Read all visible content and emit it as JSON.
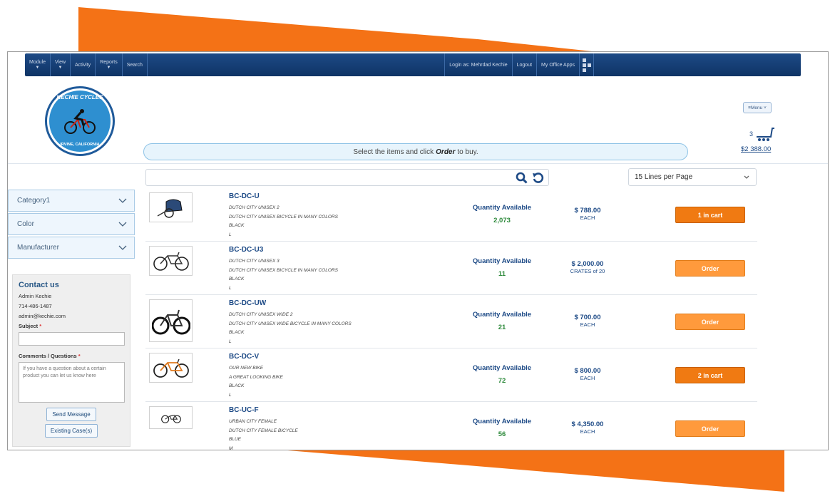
{
  "nav": {
    "items": [
      "Module",
      "View",
      "Activity",
      "Reports",
      "Search"
    ],
    "right_items": [
      "Login as: Mehrdad Kechie",
      "Logout",
      "My Office Apps"
    ]
  },
  "brand": {
    "logo_top": "KECHIE CYCLES",
    "logo_bottom": "IRVINE, CALIFORNIA"
  },
  "menu_label": "≡Menu ˅",
  "cart": {
    "count": "3",
    "total": "$2 388.00"
  },
  "hint": {
    "pre": "Select the items and click",
    "emph": "Order",
    "post": "to buy."
  },
  "search": {
    "value": ""
  },
  "lines_per_page": "15 Lines per Page",
  "filters": [
    {
      "label": "Category1"
    },
    {
      "label": "Color"
    },
    {
      "label": "Manufacturer"
    }
  ],
  "contact": {
    "title": "Contact us",
    "name": "Admin Kechie",
    "phone": "714-486-1487",
    "email": "admin@kechie.com",
    "subject_label": "Subject",
    "comments_label": "Comments / Questions",
    "required_mark": "*",
    "comments_placeholder": "If you have a question about a certain product you can let us know here",
    "send_label": "Send Message",
    "cases_label": "Existing Case(s)"
  },
  "products": [
    {
      "sku": "BC-DC-U",
      "lines": [
        "DUTCH CITY UNISEX 2",
        "DUTCH CITY UNISEX BICYCLE IN MANY COLORS",
        "BLACK",
        "L"
      ],
      "qty_label": "Quantity Available",
      "qty": "2,073",
      "price": "$ 788.00",
      "unit": "EACH",
      "button": "1 in cart",
      "in_cart": true,
      "image": "child-trailer"
    },
    {
      "sku": "BC-DC-U3",
      "lines": [
        "DUTCH CITY UNISEX 3",
        "DUTCH CITY UNISEX BICYCLE IN MANY COLORS",
        "BLACK",
        "L"
      ],
      "qty_label": "Quantity Available",
      "qty": "11",
      "price": "$ 2,000.00",
      "unit": "CRATES of 20",
      "button": "Order",
      "in_cart": false,
      "image": "bicycle"
    },
    {
      "sku": "BC-DC-UW",
      "lines": [
        "DUTCH CITY UNISEX WIDE 2",
        "DUTCH CITY UNISEX WIDE BICYCLE IN MANY COLORS",
        "BLACK",
        "L"
      ],
      "qty_label": "Quantity Available",
      "qty": "21",
      "price": "$ 700.00",
      "unit": "EACH",
      "button": "Order",
      "in_cart": false,
      "image": "mountain-bike"
    },
    {
      "sku": "BC-DC-V",
      "lines": [
        "OUR NEW BIKE",
        "A GREAT LOOKING BIKE",
        "BLACK",
        "L"
      ],
      "qty_label": "Quantity Available",
      "qty": "72",
      "price": "$ 800.00",
      "unit": "EACH",
      "button": "2 in cart",
      "in_cart": true,
      "image": "road-bike"
    },
    {
      "sku": "BC-UC-F",
      "lines": [
        "URBAN CITY FEMALE",
        "DUTCH CITY FEMALE BICYCLE",
        "BLUE",
        "M"
      ],
      "qty_label": "Quantity Available",
      "qty": "56",
      "price": "$ 4,350.00",
      "unit": "EACH",
      "button": "Order",
      "in_cart": false,
      "image": "city-bike"
    }
  ],
  "colors": {
    "accent_orange": "#f07a12",
    "nav_blue": "#1d4a86",
    "qty_green": "#2e8a3c"
  }
}
